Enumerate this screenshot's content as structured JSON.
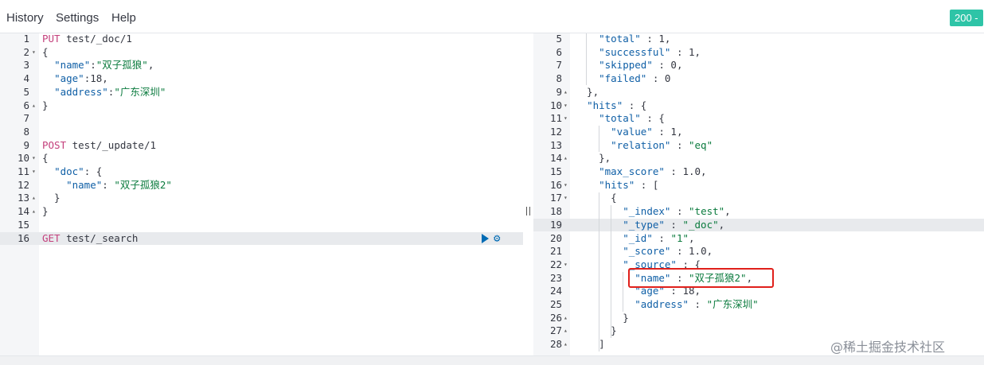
{
  "menu": {
    "history": "History",
    "settings": "Settings",
    "help": "Help"
  },
  "status_badge": "200 -",
  "request_editor": {
    "lines": [
      {
        "num": "1",
        "fold": "",
        "tokens": [
          [
            "method",
            "PUT"
          ],
          [
            "url",
            " test/_doc/1"
          ]
        ]
      },
      {
        "num": "2",
        "fold": "▾",
        "tokens": [
          [
            "punc",
            "{"
          ]
        ]
      },
      {
        "num": "3",
        "fold": "",
        "tokens": [
          [
            "punc",
            "  "
          ],
          [
            "key",
            "\"name\""
          ],
          [
            "punc",
            ":"
          ],
          [
            "str",
            "\"双子孤狼\""
          ],
          [
            "punc",
            ","
          ]
        ]
      },
      {
        "num": "4",
        "fold": "",
        "tokens": [
          [
            "punc",
            "  "
          ],
          [
            "key",
            "\"age\""
          ],
          [
            "punc",
            ":18,"
          ]
        ]
      },
      {
        "num": "5",
        "fold": "",
        "tokens": [
          [
            "punc",
            "  "
          ],
          [
            "key",
            "\"address\""
          ],
          [
            "punc",
            ":"
          ],
          [
            "str",
            "\"广东深圳\""
          ]
        ]
      },
      {
        "num": "6",
        "fold": "▴",
        "tokens": [
          [
            "punc",
            "}"
          ]
        ]
      },
      {
        "num": "7",
        "fold": "",
        "tokens": []
      },
      {
        "num": "8",
        "fold": "",
        "tokens": []
      },
      {
        "num": "9",
        "fold": "",
        "tokens": [
          [
            "method",
            "POST"
          ],
          [
            "url",
            " test/_update/1"
          ]
        ]
      },
      {
        "num": "10",
        "fold": "▾",
        "tokens": [
          [
            "punc",
            "{"
          ]
        ]
      },
      {
        "num": "11",
        "fold": "▾",
        "tokens": [
          [
            "punc",
            "  "
          ],
          [
            "key",
            "\"doc\""
          ],
          [
            "punc",
            ": {"
          ]
        ]
      },
      {
        "num": "12",
        "fold": "",
        "tokens": [
          [
            "punc",
            "    "
          ],
          [
            "key",
            "\"name\""
          ],
          [
            "punc",
            ": "
          ],
          [
            "str",
            "\"双子孤狼2\""
          ]
        ]
      },
      {
        "num": "13",
        "fold": "▴",
        "tokens": [
          [
            "punc",
            "  }"
          ]
        ]
      },
      {
        "num": "14",
        "fold": "▴",
        "tokens": [
          [
            "punc",
            "}"
          ]
        ]
      },
      {
        "num": "15",
        "fold": "",
        "tokens": []
      },
      {
        "num": "16",
        "fold": "",
        "tokens": [
          [
            "method",
            "GET"
          ],
          [
            "url",
            " test/_search"
          ]
        ],
        "active": true
      }
    ]
  },
  "response_viewer": {
    "lines": [
      {
        "num": "5",
        "fold": "",
        "tokens": [
          [
            "punc",
            "    "
          ],
          [
            "key",
            "\"total\""
          ],
          [
            "punc",
            " : 1,"
          ]
        ]
      },
      {
        "num": "6",
        "fold": "",
        "tokens": [
          [
            "punc",
            "    "
          ],
          [
            "key",
            "\"successful\""
          ],
          [
            "punc",
            " : 1,"
          ]
        ]
      },
      {
        "num": "7",
        "fold": "",
        "tokens": [
          [
            "punc",
            "    "
          ],
          [
            "key",
            "\"skipped\""
          ],
          [
            "punc",
            " : 0,"
          ]
        ]
      },
      {
        "num": "8",
        "fold": "",
        "tokens": [
          [
            "punc",
            "    "
          ],
          [
            "key",
            "\"failed\""
          ],
          [
            "punc",
            " : 0"
          ]
        ]
      },
      {
        "num": "9",
        "fold": "▴",
        "tokens": [
          [
            "punc",
            "  },"
          ]
        ]
      },
      {
        "num": "10",
        "fold": "▾",
        "tokens": [
          [
            "punc",
            "  "
          ],
          [
            "key",
            "\"hits\""
          ],
          [
            "punc",
            " : {"
          ]
        ]
      },
      {
        "num": "11",
        "fold": "▾",
        "tokens": [
          [
            "punc",
            "    "
          ],
          [
            "key",
            "\"total\""
          ],
          [
            "punc",
            " : {"
          ]
        ]
      },
      {
        "num": "12",
        "fold": "",
        "tokens": [
          [
            "punc",
            "      "
          ],
          [
            "key",
            "\"value\""
          ],
          [
            "punc",
            " : 1,"
          ]
        ]
      },
      {
        "num": "13",
        "fold": "",
        "tokens": [
          [
            "punc",
            "      "
          ],
          [
            "key",
            "\"relation\""
          ],
          [
            "punc",
            " : "
          ],
          [
            "str",
            "\"eq\""
          ]
        ]
      },
      {
        "num": "14",
        "fold": "▴",
        "tokens": [
          [
            "punc",
            "    },"
          ]
        ]
      },
      {
        "num": "15",
        "fold": "",
        "tokens": [
          [
            "punc",
            "    "
          ],
          [
            "key",
            "\"max_score\""
          ],
          [
            "punc",
            " : 1.0,"
          ]
        ]
      },
      {
        "num": "16",
        "fold": "▾",
        "tokens": [
          [
            "punc",
            "    "
          ],
          [
            "key",
            "\"hits\""
          ],
          [
            "punc",
            " : ["
          ]
        ]
      },
      {
        "num": "17",
        "fold": "▾",
        "tokens": [
          [
            "punc",
            "      {"
          ]
        ]
      },
      {
        "num": "18",
        "fold": "",
        "tokens": [
          [
            "punc",
            "        "
          ],
          [
            "key",
            "\"_index\""
          ],
          [
            "punc",
            " : "
          ],
          [
            "str",
            "\"test\""
          ],
          [
            "punc",
            ","
          ]
        ]
      },
      {
        "num": "19",
        "fold": "",
        "tokens": [
          [
            "punc",
            "        "
          ],
          [
            "key",
            "\"_type\""
          ],
          [
            "punc",
            " : "
          ],
          [
            "str",
            "\"_doc\""
          ],
          [
            "punc",
            ","
          ]
        ],
        "active": true
      },
      {
        "num": "20",
        "fold": "",
        "tokens": [
          [
            "punc",
            "        "
          ],
          [
            "key",
            "\"_id\""
          ],
          [
            "punc",
            " : "
          ],
          [
            "str",
            "\"1\""
          ],
          [
            "punc",
            ","
          ]
        ]
      },
      {
        "num": "21",
        "fold": "",
        "tokens": [
          [
            "punc",
            "        "
          ],
          [
            "key",
            "\"_score\""
          ],
          [
            "punc",
            " : 1.0,"
          ]
        ]
      },
      {
        "num": "22",
        "fold": "▾",
        "tokens": [
          [
            "punc",
            "        "
          ],
          [
            "key",
            "\"_source\""
          ],
          [
            "punc",
            " : {"
          ]
        ]
      },
      {
        "num": "23",
        "fold": "",
        "tokens": [
          [
            "punc",
            "          "
          ],
          [
            "key",
            "\"name\""
          ],
          [
            "punc",
            " : "
          ],
          [
            "str",
            "\"双子孤狼2\""
          ],
          [
            "punc",
            ","
          ]
        ]
      },
      {
        "num": "24",
        "fold": "",
        "tokens": [
          [
            "punc",
            "          "
          ],
          [
            "key",
            "\"age\""
          ],
          [
            "punc",
            " : 18,"
          ]
        ]
      },
      {
        "num": "25",
        "fold": "",
        "tokens": [
          [
            "punc",
            "          "
          ],
          [
            "key",
            "\"address\""
          ],
          [
            "punc",
            " : "
          ],
          [
            "str",
            "\"广东深圳\""
          ]
        ]
      },
      {
        "num": "26",
        "fold": "▴",
        "tokens": [
          [
            "punc",
            "        }"
          ]
        ]
      },
      {
        "num": "27",
        "fold": "▴",
        "tokens": [
          [
            "punc",
            "      }"
          ]
        ]
      },
      {
        "num": "28",
        "fold": "▴",
        "tokens": [
          [
            "punc",
            "    ]"
          ]
        ]
      }
    ]
  },
  "watermark": "@稀土掘金技术社区",
  "colors": {
    "status_green": "#2ec4a7",
    "highlight_red": "#e0201b",
    "method": "#c4407c",
    "key": "#0f5fa6",
    "string": "#0b7b3e"
  }
}
